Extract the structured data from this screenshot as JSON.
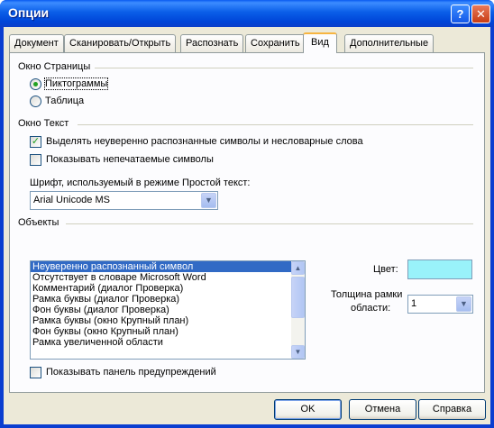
{
  "window": {
    "title": "Опции",
    "help": "?",
    "close": "✕"
  },
  "tabs": [
    {
      "label": "Документ",
      "active": false
    },
    {
      "label": "Сканировать/Открыть",
      "active": false
    },
    {
      "label": "Распознать",
      "active": false
    },
    {
      "label": "Сохранить",
      "active": false
    },
    {
      "label": "Вид",
      "active": true
    },
    {
      "label": "Дополнительные",
      "active": false
    }
  ],
  "page_window": {
    "heading": "Окно Страницы",
    "options": [
      "Пиктограммы",
      "Таблица"
    ],
    "selected": "Пиктограммы"
  },
  "text_window": {
    "heading": "Окно Текст",
    "highlight_uncertain": {
      "label": "Выделять неуверенно распознанные символы и несловарные слова",
      "checked": true
    },
    "show_nonprinting": {
      "label": "Показывать непечатаемые символы",
      "checked": false
    },
    "font_label": "Шрифт, используемый в режиме Простой текст:",
    "font_value": "Arial Unicode MS"
  },
  "objects": {
    "heading": "Объекты",
    "items": [
      "Неуверенно распознанный символ",
      "Отсутствует в словаре Microsoft Word",
      "Комментарий (диалог Проверка)",
      "Рамка буквы (диалог Проверка)",
      "Фон буквы (диалог Проверка)",
      "Рамка буквы (окно Крупный план)",
      "Фон буквы (окно Крупный план)",
      "Рамка увеличенной области"
    ],
    "selected_index": 0,
    "color_label": "Цвет:",
    "color_value": "#99f2fa",
    "thickness_label_line1": "Толщина рамки",
    "thickness_label_line2": "области:",
    "thickness_value": "1",
    "show_warnings": {
      "label": "Показывать панель предупреждений",
      "checked": false
    }
  },
  "buttons": {
    "ok": "OK",
    "cancel": "Отмена",
    "help": "Справка"
  }
}
